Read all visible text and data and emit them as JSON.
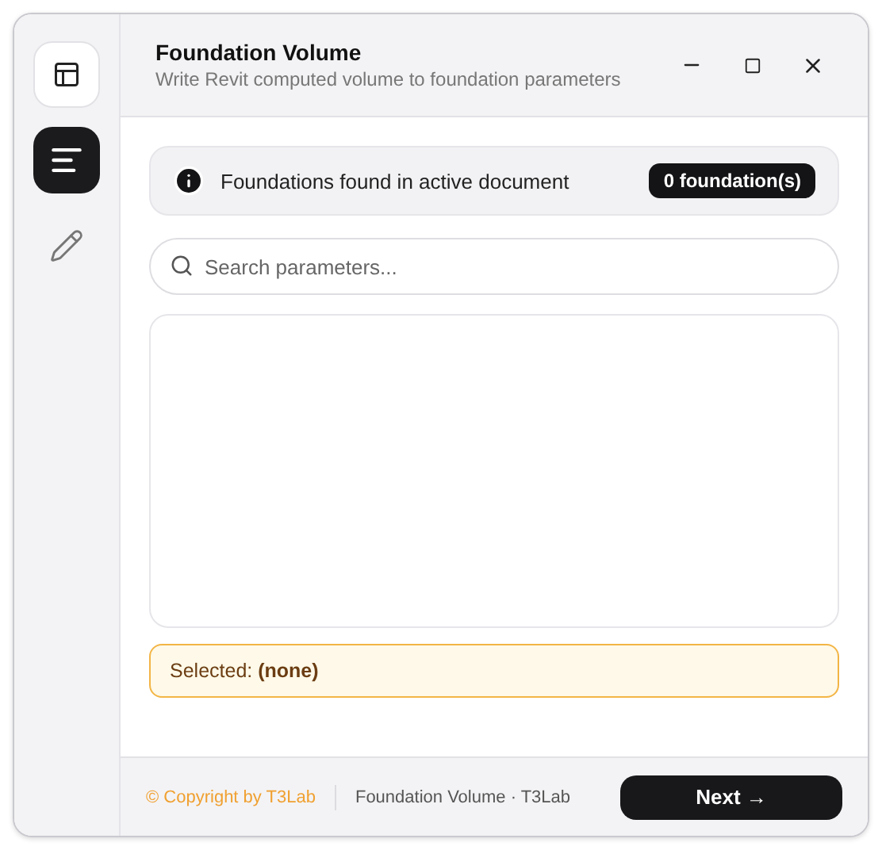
{
  "window": {
    "title": "Foundation Volume",
    "subtitle": "Write Revit computed volume to foundation parameters"
  },
  "sidebar": {
    "items": [
      {
        "kind": "list",
        "selected": true
      },
      {
        "kind": "edit",
        "selected": false
      }
    ]
  },
  "info": {
    "text": "Foundations found in active document",
    "badge": "0 foundation(s)"
  },
  "search": {
    "placeholder": "Search parameters..."
  },
  "selection": {
    "text": "Selected: **(none)**"
  },
  "footer": {
    "copyright": "© Copyright by T3Lab",
    "product": "Foundation Volume · T3Lab",
    "next_button": "Next →"
  }
}
